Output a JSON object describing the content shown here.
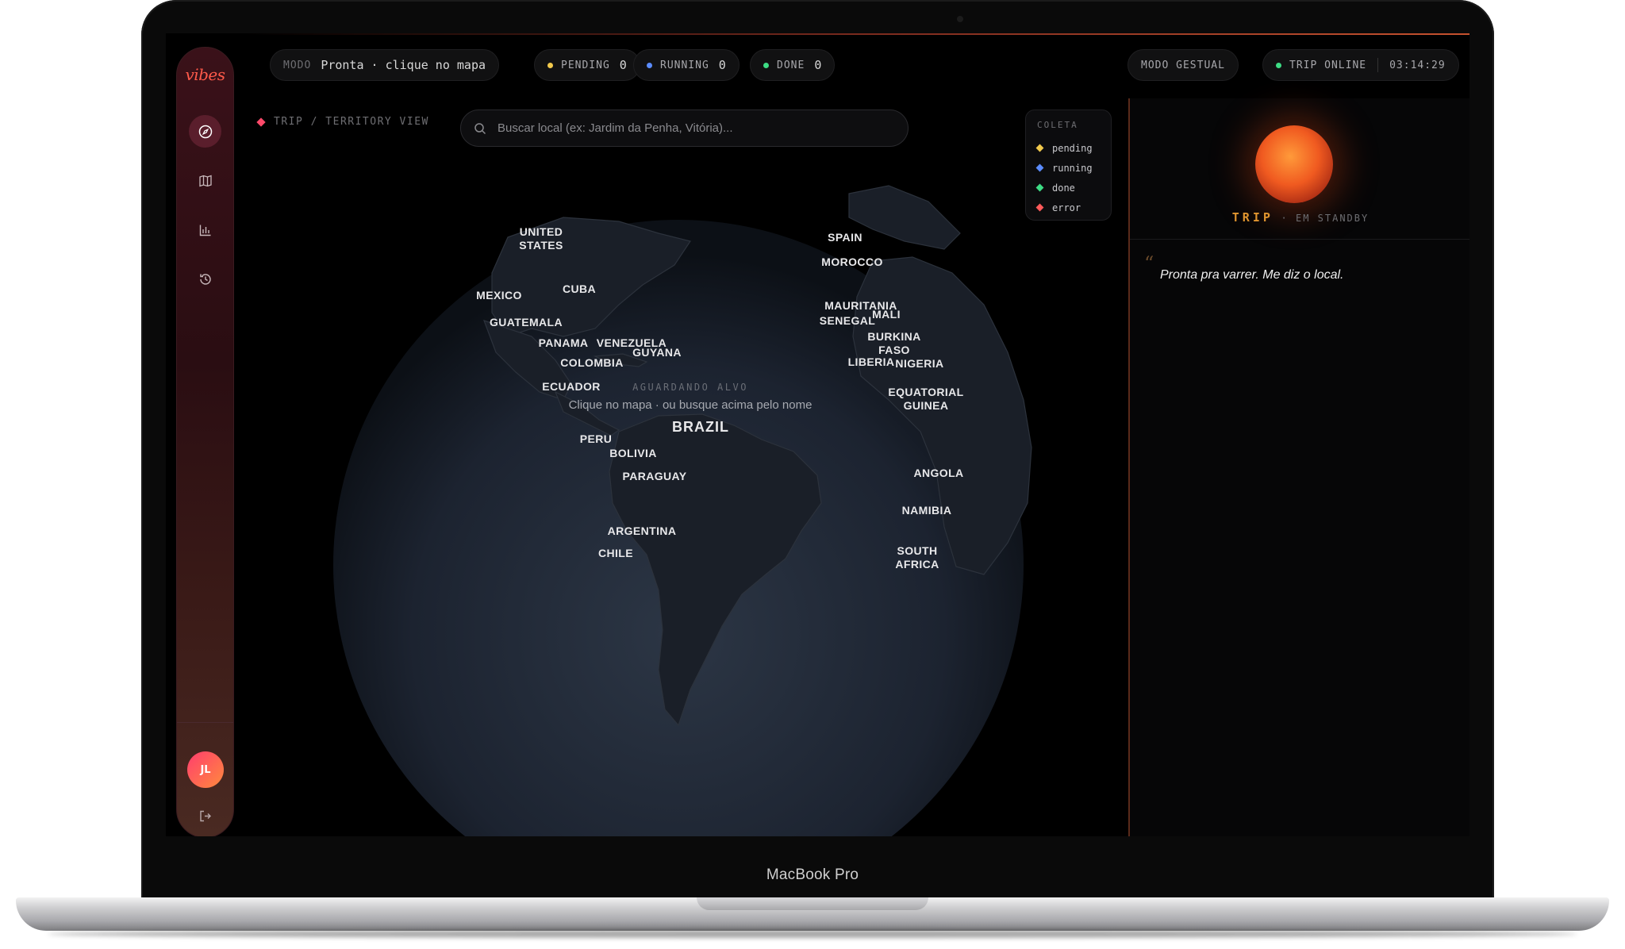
{
  "device": {
    "label": "MacBook Pro"
  },
  "sidebar": {
    "logo": "vibes",
    "nav": [
      "compass-icon",
      "map-icon",
      "bar-chart-icon",
      "history-icon"
    ],
    "avatar_initials": "JL"
  },
  "topbar": {
    "mode_key": "MODO",
    "mode_value": "Pronta · clique no mapa",
    "pending": {
      "label": "PENDING",
      "count": "0"
    },
    "running": {
      "label": "RUNNING",
      "count": "0"
    },
    "done": {
      "label": "DONE",
      "count": "0"
    },
    "gesture_mode": "MODO GESTUAL",
    "status": "TRIP ONLINE",
    "clock": "03:14:29"
  },
  "map": {
    "breadcrumb": "TRIP / TERRITORY VIEW",
    "search_placeholder": "Buscar local (ex: Jardim da Penha, Vitória)...",
    "legend": {
      "title": "COLETA",
      "items": [
        {
          "label": "pending",
          "color": "#f2c94c"
        },
        {
          "label": "running",
          "color": "#5b8cff"
        },
        {
          "label": "done",
          "color": "#3ddc84"
        },
        {
          "label": "error",
          "color": "#ff5a5a"
        }
      ]
    },
    "countries": {
      "united_states": "UNITED\nSTATES",
      "mexico": "MEXICO",
      "cuba": "CUBA",
      "guatemala": "GUATEMALA",
      "panama": "PANAMA",
      "venezuela": "VENEZUELA",
      "guyana": "GUYANA",
      "colombia": "COLOMBIA",
      "ecuador": "ECUADOR",
      "peru": "PERU",
      "bolivia": "BOLIVIA",
      "brazil": "BRAZIL",
      "paraguay": "PARAGUAY",
      "argentina": "ARGENTINA",
      "chile": "CHILE",
      "spain": "SPAIN",
      "morocco": "MOROCCO",
      "mauritania": "MAURITANIA",
      "senegal": "SENEGAL",
      "mali": "MALI",
      "burkina_faso": "BURKINA\nFASO",
      "liberia": "LIBERIA",
      "nigeria": "NIGERIA",
      "equatorial_guinea": "EQUATORIAL\nGUINEA",
      "angola": "ANGOLA",
      "namibia": "NAMIBIA",
      "south_africa": "SOUTH\nAFRICA"
    },
    "awaiting_title": "AGUARDANDO ALVO",
    "awaiting_sub": "Clique no mapa · ou busque acima pelo nome"
  },
  "assistant": {
    "name": "TRIP",
    "state": "· EM STANDBY",
    "message": "Pronta pra varrer. Me diz o local."
  }
}
